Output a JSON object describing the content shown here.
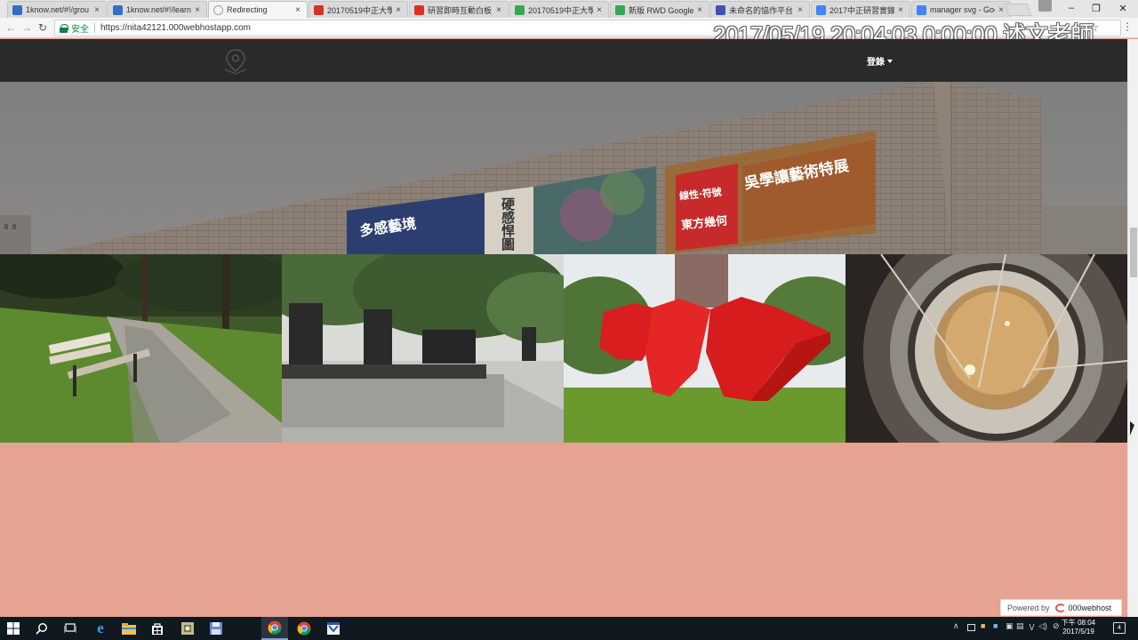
{
  "browser": {
    "tabs": [
      {
        "title": "1know.net/#!/grou",
        "favicon": "1know-icon",
        "color": "#2f6fc7",
        "active": false
      },
      {
        "title": "1know.net/#!/learn",
        "favicon": "1know-icon",
        "color": "#2f6fc7",
        "active": false
      },
      {
        "title": "Redirecting",
        "favicon": "loading-icon",
        "color": "#9aa3ad",
        "active": true
      },
      {
        "title": "20170519中正大學",
        "favicon": "pdf-icon",
        "color": "#d93025",
        "active": false
      },
      {
        "title": "研習即時互動白板",
        "favicon": "whiteboard-icon",
        "color": "#d93025",
        "active": false
      },
      {
        "title": "20170519中正大學",
        "favicon": "google-drive-icon",
        "color": "#34a853",
        "active": false
      },
      {
        "title": "新版 RWD Google",
        "favicon": "google-drive-icon",
        "color": "#34a853",
        "active": false
      },
      {
        "title": "未命名的協作平台",
        "favicon": "google-sites-icon",
        "color": "#3f51b5",
        "active": false
      },
      {
        "title": "2017中正研習實錄",
        "favicon": "google-docs-icon",
        "color": "#4285f4",
        "active": false
      },
      {
        "title": "manager svg - Goo",
        "favicon": "google-icon",
        "color": "#4285f4",
        "active": false
      }
    ],
    "address": {
      "secure_label": "安全",
      "url": "https://nita42121.000webhostapp.com"
    },
    "window_controls": {
      "minimize": "–",
      "maximize": "❐",
      "close": "✕"
    }
  },
  "overlay": {
    "timestamp": "2017/05/19 20:04:03 0:00:00 述文老師"
  },
  "site": {
    "nav": {
      "logo_icon": "map-pin-icon",
      "login_label": "登錄"
    },
    "hero": {
      "banners": [
        {
          "text": "多感藝境"
        },
        {
          "text": "硬感悍圖"
        },
        {
          "text": "線性‧符號"
        },
        {
          "text": "東方幾何"
        },
        {
          "text": "吳學讓藝術特展"
        }
      ]
    },
    "photos": [
      {
        "subject": "park bench on grassy path"
      },
      {
        "subject": "stone stele monuments"
      },
      {
        "subject": "red geometric sculpture"
      },
      {
        "subject": "spiral staircase ceiling"
      }
    ],
    "footer_badge": {
      "prefix": "Powered by",
      "brand": "000webhost"
    }
  },
  "taskbar": {
    "apps": [
      "start-icon",
      "search-icon",
      "task-view-icon",
      "edge-icon",
      "file-explorer-icon",
      "store-icon",
      "app-icon",
      "save-icon",
      "chrome-icon",
      "chrome-icon",
      "app-icon"
    ],
    "clock": {
      "time": "下午 08:04",
      "date": "2017/5/19"
    },
    "notifications_count": "4"
  }
}
